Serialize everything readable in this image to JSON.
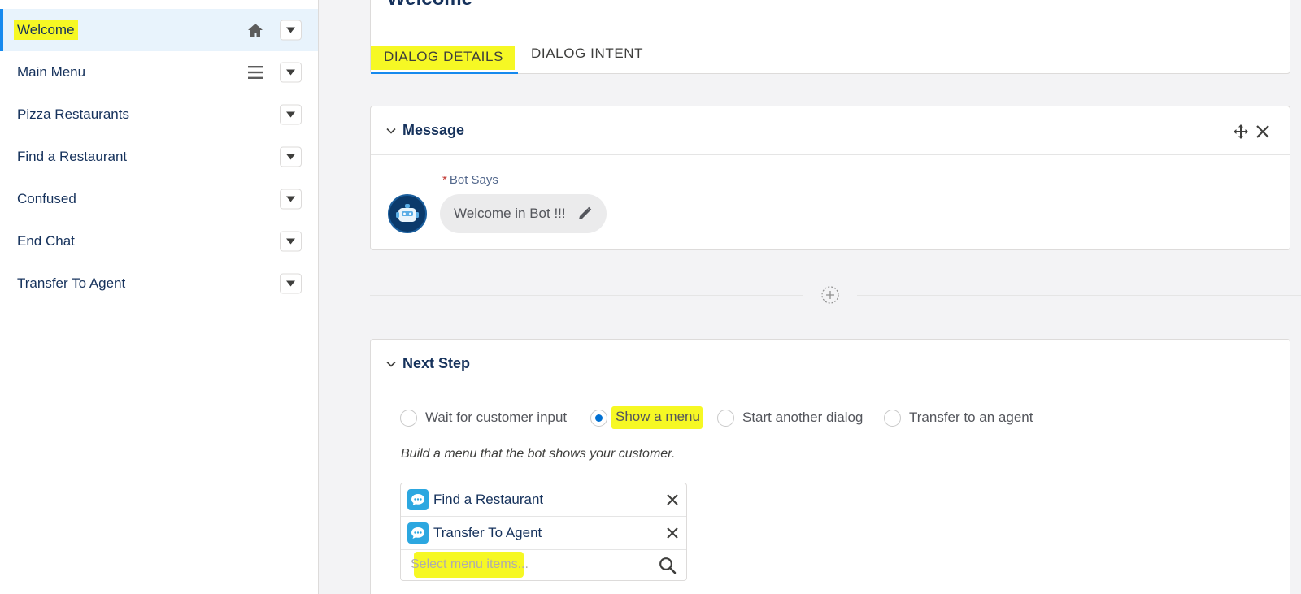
{
  "sidebar": {
    "items": [
      {
        "label": "Welcome",
        "active": true,
        "icon": "home-icon"
      },
      {
        "label": "Main Menu",
        "icon": "menu-lines-icon"
      },
      {
        "label": "Pizza Restaurants"
      },
      {
        "label": "Find a Restaurant"
      },
      {
        "label": "Confused"
      },
      {
        "label": "End Chat"
      },
      {
        "label": "Transfer To Agent"
      }
    ]
  },
  "header": {
    "title": "Welcome"
  },
  "tabs": [
    {
      "label": "DIALOG DETAILS",
      "active": true
    },
    {
      "label": "DIALOG INTENT",
      "active": false
    }
  ],
  "message": {
    "title": "Message",
    "bot_says_label": "Bot Says",
    "required_marker": "*",
    "text": "Welcome in Bot !!!"
  },
  "next_step": {
    "title": "Next Step",
    "options": [
      {
        "label": "Wait for customer input",
        "checked": false
      },
      {
        "label": "Show a menu",
        "checked": true
      },
      {
        "label": "Start another dialog",
        "checked": false
      },
      {
        "label": "Transfer to an agent",
        "checked": false
      }
    ],
    "help_text": "Build a menu that the bot shows your customer.",
    "menu_items": [
      {
        "label": "Find a Restaurant",
        "icon": "chat-bubble-icon"
      },
      {
        "label": "Transfer To Agent",
        "icon": "chat-bubble-icon"
      }
    ],
    "search_placeholder": "Select menu items..."
  },
  "colors": {
    "accent": "#1589ee",
    "highlight": "#f6f824",
    "radio_checked": "#0070d2",
    "chat_icon": "#2ca7e0",
    "title_text": "#16325c"
  }
}
